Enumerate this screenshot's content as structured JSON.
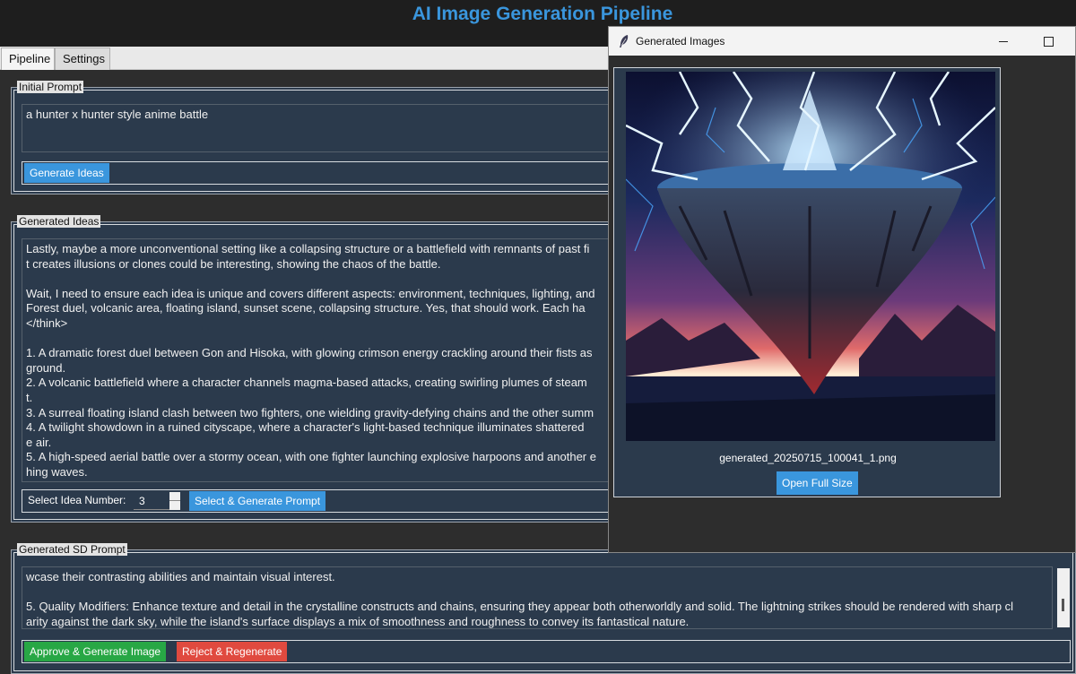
{
  "app": {
    "title": "AI Image Generation Pipeline"
  },
  "tabs": [
    {
      "label": "Pipeline"
    },
    {
      "label": "Settings"
    }
  ],
  "initial_prompt": {
    "label": "Initial Prompt",
    "text": "a hunter x hunter style anime battle",
    "generate_button": "Generate Ideas"
  },
  "generated_ideas": {
    "label": "Generated Ideas",
    "text": "Lastly, maybe a more unconventional setting like a collapsing structure or a battlefield with remnants of past fi\nt creates illusions or clones could be interesting, showing the chaos of the battle.\n\nWait, I need to ensure each idea is unique and covers different aspects: environment, techniques, lighting, and\nForest duel, volcanic area, floating island, sunset scene, collapsing structure. Yes, that should work. Each ha\n</think>\n\n1. A dramatic forest duel between Gon and Hisoka, with glowing crimson energy crackling around their fists as\nground.\n2. A volcanic battlefield where a character channels magma-based attacks, creating swirling plumes of steam\nt.\n3. A surreal floating island clash between two fighters, one wielding gravity-defying chains and the other summ\n4. A twilight showdown in a ruined cityscape, where a character's light-based technique illuminates shattered\ne air.\n5. A high-speed aerial battle over a stormy ocean, with one fighter launching explosive harpoons and another e\nhing waves.",
    "select_label": "Select Idea Number:",
    "idea_number": "3",
    "select_button": "Select & Generate Prompt"
  },
  "sd_prompt": {
    "label": "Generated SD Prompt",
    "text": "wcase their contrasting abilities and maintain visual interest.\n\n5. Quality Modifiers: Enhance texture and detail in the crystalline constructs and chains, ensuring they appear both otherworldly and solid. The lightning strikes should be rendered with sharp cl\narity against the dark sky, while the island's surface displays a mix of smoothness and roughness to convey its fantastical nature.",
    "approve_button": "Approve & Generate Image",
    "reject_button": "Reject & Regenerate"
  },
  "popup": {
    "title": "Generated Images",
    "filename": "generated_20250715_100041_1.png",
    "open_button": "Open Full Size"
  },
  "colors": {
    "accent_blue": "#3a96dd",
    "approve_green": "#28a745",
    "reject_red": "#e04a3f",
    "panel_bg": "#2b3a4c"
  }
}
